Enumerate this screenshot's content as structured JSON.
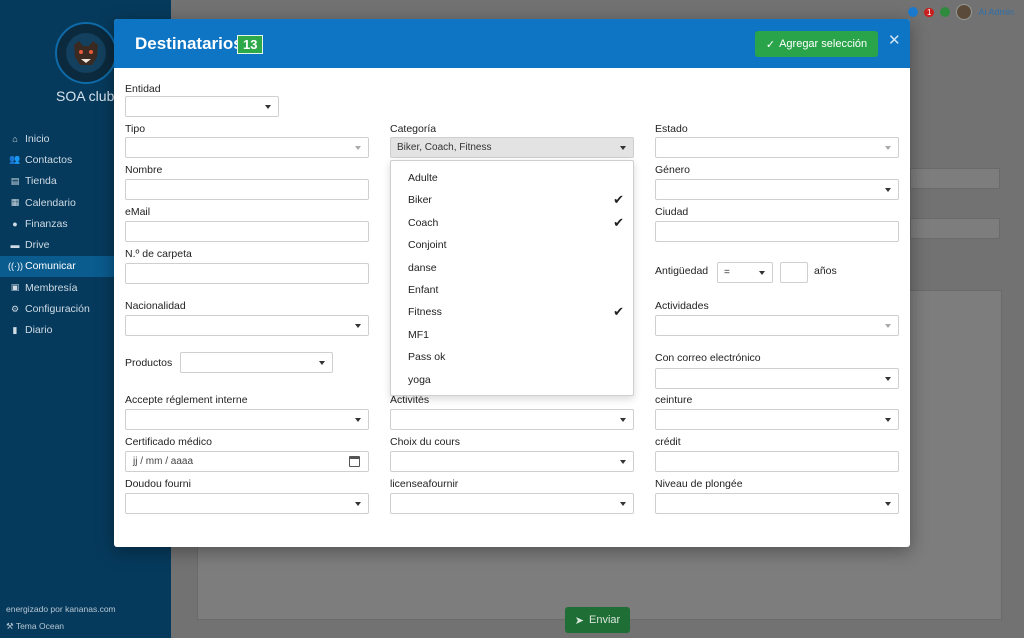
{
  "app": {
    "club_name": "SOA club",
    "powered_by": "energizado por kananas.com",
    "theme": "Tema Ocean",
    "notification_count": "1",
    "user_name": "Ai Admin"
  },
  "sidebar": {
    "items": [
      {
        "label": "Inicio",
        "icon": "home-icon"
      },
      {
        "label": "Contactos",
        "icon": "users-icon"
      },
      {
        "label": "Tienda",
        "icon": "store-icon"
      },
      {
        "label": "Calendario",
        "icon": "calendar-icon"
      },
      {
        "label": "Finanzas",
        "icon": "piggy-bank-icon"
      },
      {
        "label": "Drive",
        "icon": "drive-icon"
      },
      {
        "label": "Comunicar",
        "icon": "broadcast-icon"
      },
      {
        "label": "Membresía",
        "icon": "id-card-icon"
      },
      {
        "label": "Configuración",
        "icon": "cog-icon"
      },
      {
        "label": "Diario",
        "icon": "book-icon"
      }
    ],
    "active": "Comunicar"
  },
  "background": {
    "send_label": "Enviar"
  },
  "modal": {
    "title": "Destinatarios",
    "count": "13",
    "add_label": "Agregar selección",
    "fields": {
      "entidad": "Entidad",
      "tipo": "Tipo",
      "categoria": "Categoría",
      "categoria_value": "Biker, Coach, Fitness",
      "estado": "Estado",
      "nombre": "Nombre",
      "genero": "Género",
      "email": "eMail",
      "ciudad": "Ciudad",
      "carpeta": "N.º de carpeta",
      "antiguedad": "Antigüedad",
      "antiguedad_op": "=",
      "anos": "años",
      "nacionalidad": "Nacionalidad",
      "actividades": "Actividades",
      "productos": "Productos",
      "correo": "Con correo electrónico",
      "reglement": "Accepte réglement interne",
      "activites": "Activités",
      "ceinture": "ceinture",
      "certificado": "Certificado médico",
      "date_placeholder": "jj / mm / aaaa",
      "choix": "Choix du cours",
      "credit": "crédit",
      "doudou": "Doudou fourni",
      "license": "licenseafournir",
      "plongee": "Niveau de plongée"
    },
    "category_options": [
      {
        "label": "Adulte",
        "checked": false
      },
      {
        "label": "Biker",
        "checked": true
      },
      {
        "label": "Coach",
        "checked": true
      },
      {
        "label": "Conjoint",
        "checked": false
      },
      {
        "label": "danse",
        "checked": false
      },
      {
        "label": "Enfant",
        "checked": false
      },
      {
        "label": "Fitness",
        "checked": true
      },
      {
        "label": "MF1",
        "checked": false
      },
      {
        "label": "Pass ok",
        "checked": false
      },
      {
        "label": "yoga",
        "checked": false
      }
    ],
    "check_glyph": "✔"
  }
}
